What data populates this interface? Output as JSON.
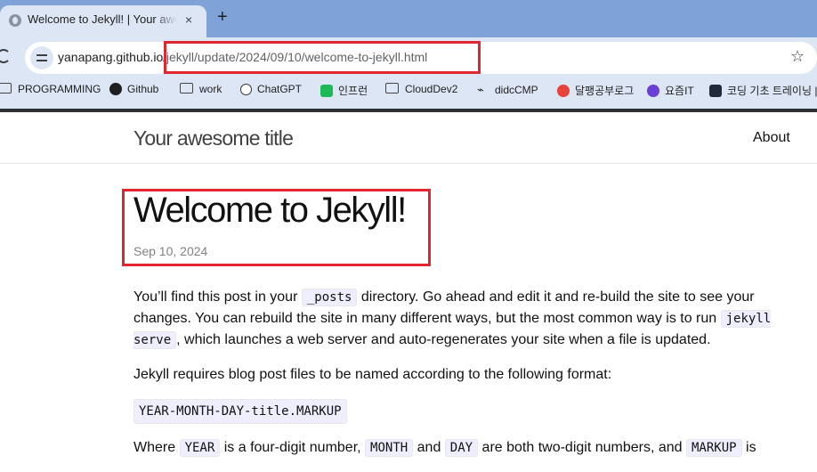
{
  "browser": {
    "tab": {
      "title": "Welcome to Jekyll! | Your awesome title",
      "close": "×"
    },
    "new_tab": "+",
    "address": {
      "host": "yanapang.github.io",
      "path": "/jekyll/update/2024/09/10/welcome-to-jekyll.html"
    },
    "bookmarks": [
      {
        "label": "PROGRAMMING",
        "icon": "folder-icon"
      },
      {
        "label": "Github",
        "icon": "github-icon"
      },
      {
        "label": "work",
        "icon": "folder-icon"
      },
      {
        "label": "ChatGPT",
        "icon": "chatgpt-icon"
      },
      {
        "label": "인프런",
        "icon": "inflearn-icon"
      },
      {
        "label": "CloudDev2",
        "icon": "folder-icon"
      },
      {
        "label": "didcCMP",
        "icon": "didc-icon"
      },
      {
        "label": "달팽공부로그",
        "icon": "blog-icon"
      },
      {
        "label": "요즘IT",
        "icon": "yozm-icon"
      },
      {
        "label": "코딩 기초 트레이닝 | 프...",
        "icon": "programmers-icon"
      }
    ]
  },
  "site": {
    "title": "Your awesome title",
    "nav": {
      "about": "About"
    }
  },
  "post": {
    "title": "Welcome to Jekyll!",
    "date": "Sep 10, 2024",
    "p1": {
      "a": "You’ll find this post in your ",
      "code1": "_posts",
      "b": " directory. Go ahead and edit it and re-build the site to see your changes. You can rebuild the site in many different ways, but the most common way is to run ",
      "code2": "jekyll serve",
      "c": ", which launches a web server and auto-regenerates your site when a file is updated."
    },
    "p2": "Jekyll requires blog post files to be named according to the following format:",
    "format_code": "YEAR-MONTH-DAY-title.MARKUP",
    "p3": {
      "a": "Where ",
      "code1": "YEAR",
      "b": " is a four-digit number, ",
      "code2": "MONTH",
      "c": " and ",
      "code3": "DAY",
      "d": " are both two-digit numbers, and ",
      "code4": "MARKUP",
      "e": " is"
    }
  },
  "colors": {
    "highlight": "#e0262e",
    "tabstrip": "#7fa3d6",
    "toolbar": "#dde6f5"
  }
}
